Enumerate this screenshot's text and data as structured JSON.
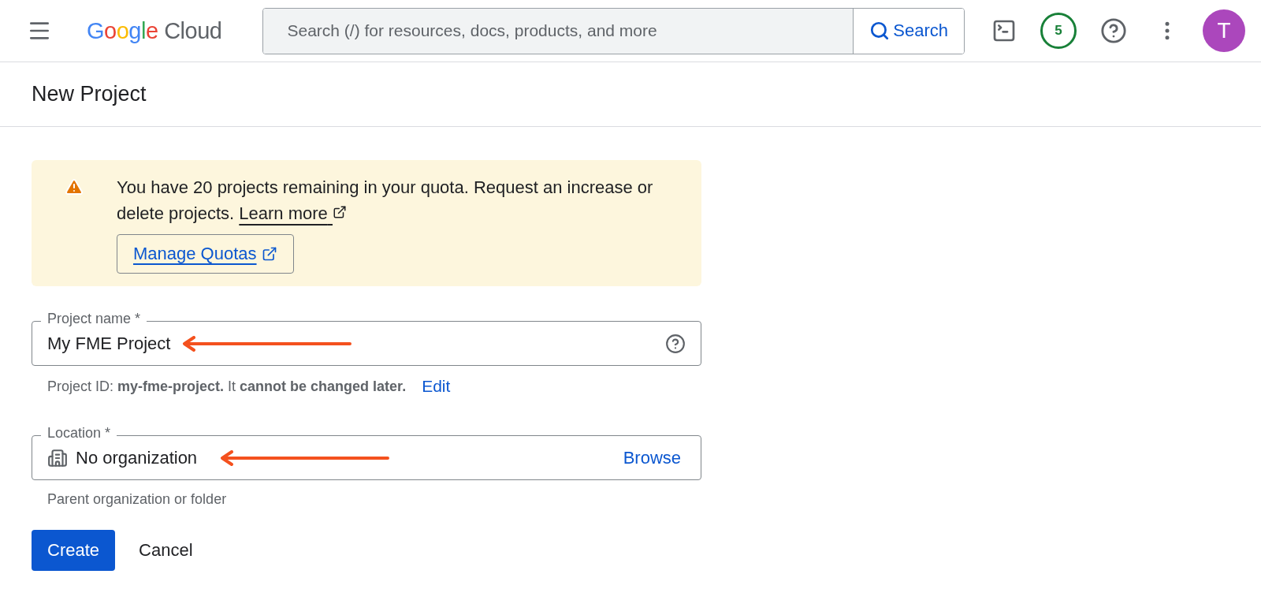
{
  "header": {
    "logo": "Google Cloud",
    "search": {
      "placeholder": "Search (/) for resources, docs, products, and more",
      "button": "Search"
    },
    "badge": "5",
    "avatar": "T"
  },
  "page_title": "New Project",
  "banner": {
    "text": "You have 20 projects remaining in your quota. Request an increase or delete projects.",
    "link": "Learn more",
    "button": "Manage Quotas"
  },
  "project_name": {
    "label": "Project name *",
    "value": "My FME Project",
    "helper": "Project ID: **my-fme-project.** It **cannot be changed later.**",
    "edit": "Edit"
  },
  "location": {
    "label": "Location *",
    "value": "No organization",
    "action": "Browse",
    "helper": "Parent organization or folder"
  },
  "buttons": [
    {
      "label": "Create",
      "kind": "primary"
    },
    {
      "label": "Cancel",
      "kind": "text"
    }
  ]
}
